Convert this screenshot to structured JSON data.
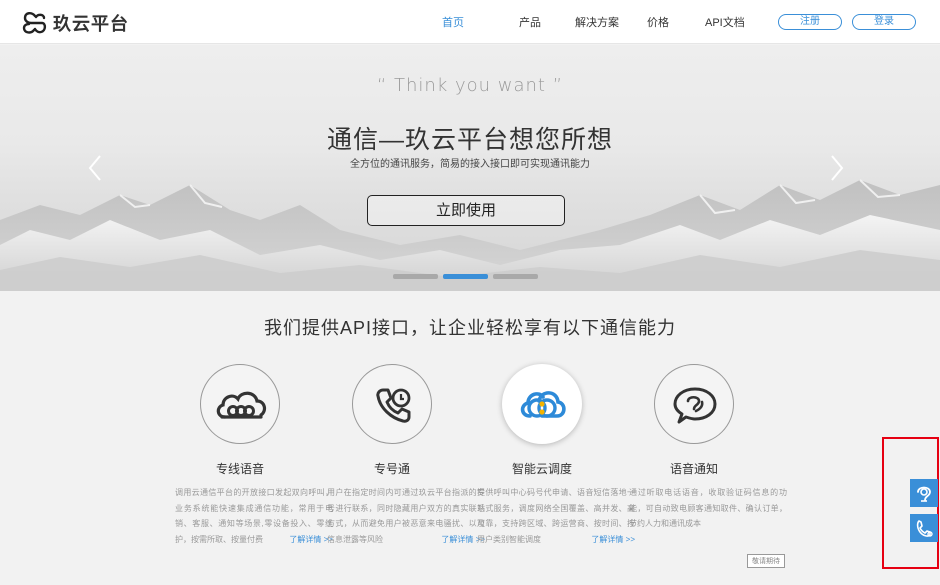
{
  "header": {
    "brand": "玖云平台",
    "nav": [
      {
        "label": "首页",
        "active": true
      },
      {
        "label": "产品",
        "active": false
      },
      {
        "label": "解决方案",
        "active": false
      },
      {
        "label": "价格",
        "active": false
      },
      {
        "label": "API文档",
        "active": false
      }
    ],
    "register_label": "注册",
    "login_label": "登录"
  },
  "banner": {
    "quote": "“ Think  you  want ”",
    "title": "通信—玖云平台想您所想",
    "subtitle": "全方位的通讯服务，简易的接入接口即可实现通讯能力",
    "cta_label": "立即使用",
    "slide_count": 3,
    "active_slide": 2
  },
  "section": {
    "title": "我们提供API接口，让企业轻松享有以下通信能力"
  },
  "features": [
    {
      "name": "专线语音",
      "icon": "cloud-chain-icon",
      "desc": "调用云通信平台的开放接口发起双向呼叫，业务系统能快速集成通信功能，常用于电销、客服、通知等场景,零设备投入、零维护，按需所取、按量付费",
      "link": "了解详情 >>"
    },
    {
      "name": "专号通",
      "icon": "phone-icon",
      "desc": "用户在指定时间内可通过玖云平台指派的专号进行联系，同时隐藏用户双方的真实联系方式，从而避免用户被恶意来电骚扰、以及信息泄露等风险",
      "link": "了解详情 >>"
    },
    {
      "name": "智能云调度",
      "icon": "cloud-link-icon",
      "desc": "提供呼叫中心码号代申请、语音短信落地一站式服务，调度网络全国覆盖、高并发、高可靠，支持跨区域、跨运营商、按时间、按用户类别智能调度",
      "link": "了解详情 >>"
    },
    {
      "name": "语音通知",
      "icon": "speech-bubble-icon",
      "desc": "通过听取电话语音，收取验证码信息的功能，可自动致电顾客通知取件、确认订单，节约人力和通讯成本",
      "link": "敬请期待"
    }
  ],
  "colors": {
    "accent": "#3a8fd8",
    "highlight_border": "#e60012"
  }
}
